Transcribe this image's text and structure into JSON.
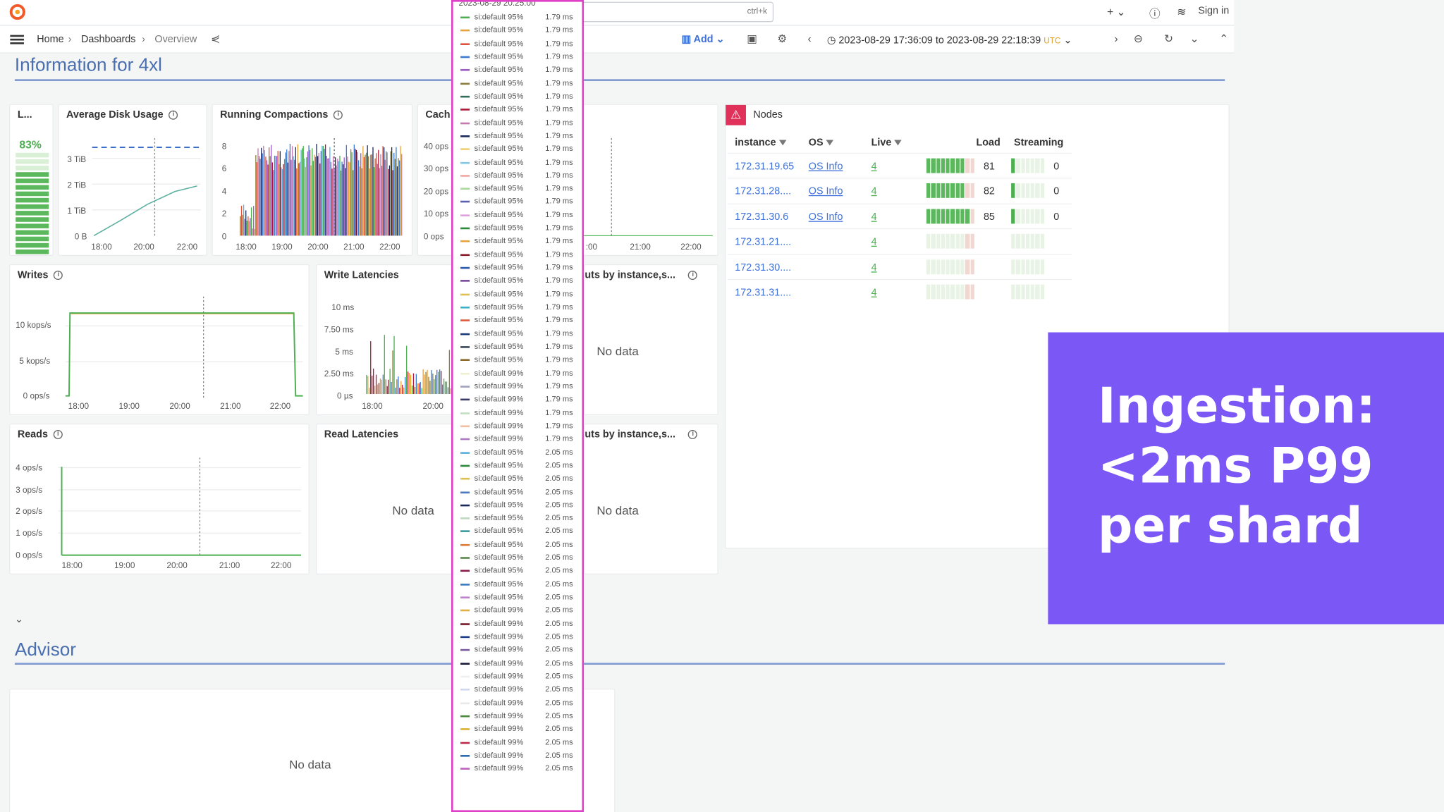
{
  "topbar": {
    "search_shortcut": "ctrl+k",
    "plus_label": "+ ⌄",
    "help_icon": "help-icon",
    "news_icon": "rss-icon",
    "signin_label": "Sign in"
  },
  "breadcrumb": {
    "home": "Home",
    "dashboards": "Dashboards",
    "current": "Overview"
  },
  "toolbar": {
    "add_label": "Add",
    "time_range": "2023-08-29 17:36:09 to 2023-08-29 22:18:39",
    "timezone": "UTC"
  },
  "sections": {
    "info_title": "Information for 4xl",
    "advisor_title": "Advisor"
  },
  "panels": {
    "live": {
      "title": "L...",
      "value": "83%",
      "fraction": 0.83
    },
    "disk": {
      "title": "Average Disk Usage",
      "y_ticks": [
        "3 TiB",
        "2 TiB",
        "1 TiB",
        "0 B"
      ],
      "x_ticks": [
        "18:00",
        "20:00",
        "22:00"
      ]
    },
    "compactions": {
      "title": "Running Compactions",
      "y_ticks": [
        "8",
        "6",
        "4",
        "2",
        "0"
      ],
      "x_ticks": [
        "18:00",
        "19:00",
        "20:00",
        "21:00",
        "22:00"
      ]
    },
    "cache": {
      "title": "Cach",
      "y_ticks": [
        "40 ops",
        "30 ops",
        "20 ops",
        "10 ops",
        "0 ops"
      ],
      "x_ticks": [
        ":00",
        "21:00",
        "22:00"
      ]
    },
    "writes": {
      "title": "Writes",
      "y_ticks": [
        "10 kops/s",
        "5 kops/s",
        "0 ops/s"
      ],
      "x_ticks": [
        "18:00",
        "19:00",
        "20:00",
        "21:00",
        "22:00"
      ]
    },
    "write_latencies": {
      "title": "Write Latencies",
      "y_ticks": [
        "10 ms",
        "7.50 ms",
        "5 ms",
        "2.50 ms",
        "0 µs"
      ],
      "x_ticks": [
        "18:00",
        "20:00"
      ]
    },
    "timeouts_write": {
      "title": "uts by instance,s...",
      "empty": "No data"
    },
    "reads": {
      "title": "Reads",
      "y_ticks": [
        "4 ops/s",
        "3 ops/s",
        "2 ops/s",
        "1 ops/s",
        "0 ops/s"
      ],
      "x_ticks": [
        "18:00",
        "19:00",
        "20:00",
        "21:00",
        "22:00"
      ]
    },
    "read_latencies": {
      "title": "Read Latencies",
      "empty": "No data"
    },
    "timeouts_read": {
      "title": "uts by instance,s...",
      "empty": "No data"
    },
    "advisor_panel": {
      "empty": "No data"
    }
  },
  "nodes": {
    "title": "Nodes",
    "columns": [
      "instance",
      "OS",
      "Live",
      "Load",
      "Streaming"
    ],
    "rows": [
      {
        "instance": "172.31.19.65",
        "os": "OS Info",
        "live": "4",
        "load": "81",
        "load_frac": 0.81,
        "streaming": "0"
      },
      {
        "instance": "172.31.28....",
        "os": "OS Info",
        "live": "4",
        "load": "82",
        "load_frac": 0.82,
        "streaming": "0"
      },
      {
        "instance": "172.31.30.6",
        "os": "OS Info",
        "live": "4",
        "load": "85",
        "load_frac": 0.85,
        "streaming": "0"
      },
      {
        "instance": "172.31.21....",
        "os": "",
        "live": "4",
        "load": "",
        "load_frac": 0,
        "streaming": ""
      },
      {
        "instance": "172.31.30....",
        "os": "",
        "live": "4",
        "load": "",
        "load_frac": 0,
        "streaming": ""
      },
      {
        "instance": "172.31.31....",
        "os": "",
        "live": "4",
        "load": "",
        "load_frac": 0,
        "streaming": ""
      }
    ]
  },
  "tooltip": {
    "header": "2023-08-29 20:25:00",
    "rows": [
      {
        "label": "si:default 95%",
        "value": "1.79 ms",
        "color": "#4caf50"
      },
      {
        "label": "si:default 95%",
        "value": "1.79 ms",
        "color": "#e8a33c"
      },
      {
        "label": "si:default 95%",
        "value": "1.79 ms",
        "color": "#e0533c"
      },
      {
        "label": "si:default 95%",
        "value": "1.79 ms",
        "color": "#3a7bd5"
      },
      {
        "label": "si:default 95%",
        "value": "1.79 ms",
        "color": "#9c5cc8"
      },
      {
        "label": "si:default 95%",
        "value": "1.79 ms",
        "color": "#8e7d3a"
      },
      {
        "label": "si:default 95%",
        "value": "1.79 ms",
        "color": "#2f6e5a"
      },
      {
        "label": "si:default 95%",
        "value": "1.79 ms",
        "color": "#b0183a"
      },
      {
        "label": "si:default 95%",
        "value": "1.79 ms",
        "color": "#c47ab0"
      },
      {
        "label": "si:default 95%",
        "value": "1.79 ms",
        "color": "#1d2a5c"
      },
      {
        "label": "si:default 95%",
        "value": "1.79 ms",
        "color": "#f0d070"
      },
      {
        "label": "si:default 95%",
        "value": "1.79 ms",
        "color": "#80c8e8"
      },
      {
        "label": "si:default 95%",
        "value": "1.79 ms",
        "color": "#f4a6a0"
      },
      {
        "label": "si:default 95%",
        "value": "1.79 ms",
        "color": "#a7d89a"
      },
      {
        "label": "si:default 95%",
        "value": "1.79 ms",
        "color": "#5a5fb0"
      },
      {
        "label": "si:default 95%",
        "value": "1.79 ms",
        "color": "#e0a0e0"
      },
      {
        "label": "si:default 95%",
        "value": "1.79 ms",
        "color": "#2a8a3a"
      },
      {
        "label": "si:default 95%",
        "value": "1.79 ms",
        "color": "#e8a33c"
      },
      {
        "label": "si:default 95%",
        "value": "1.79 ms",
        "color": "#8a1a2a"
      },
      {
        "label": "si:default 95%",
        "value": "1.79 ms",
        "color": "#2a5ab0"
      },
      {
        "label": "si:default 95%",
        "value": "1.79 ms",
        "color": "#7a4a9a"
      },
      {
        "label": "si:default 95%",
        "value": "1.79 ms",
        "color": "#e0c050"
      },
      {
        "label": "si:default 95%",
        "value": "1.79 ms",
        "color": "#3ab0c8"
      },
      {
        "label": "si:default 95%",
        "value": "1.79 ms",
        "color": "#e05a3a"
      },
      {
        "label": "si:default 95%",
        "value": "1.79 ms",
        "color": "#1a3a7a"
      },
      {
        "label": "si:default 95%",
        "value": "1.79 ms",
        "color": "#3a4a5a"
      },
      {
        "label": "si:default 95%",
        "value": "1.79 ms",
        "color": "#8a6a2a"
      },
      {
        "label": "si:default 99%",
        "value": "1.79 ms",
        "color": "#f0f0d0"
      },
      {
        "label": "si:default 99%",
        "value": "1.79 ms",
        "color": "#a0a0c0"
      },
      {
        "label": "si:default 99%",
        "value": "1.79 ms",
        "color": "#3a3a6a"
      },
      {
        "label": "si:default 99%",
        "value": "1.79 ms",
        "color": "#c0e0c0"
      },
      {
        "label": "si:default 99%",
        "value": "1.79 ms",
        "color": "#f0c0a0"
      },
      {
        "label": "si:default 99%",
        "value": "1.79 ms",
        "color": "#b07ac0"
      },
      {
        "label": "si:default 95%",
        "value": "2.05 ms",
        "color": "#5ab0e0"
      },
      {
        "label": "si:default 95%",
        "value": "2.05 ms",
        "color": "#2a8a3a"
      },
      {
        "label": "si:default 95%",
        "value": "2.05 ms",
        "color": "#e0c050"
      },
      {
        "label": "si:default 95%",
        "value": "2.05 ms",
        "color": "#4a7ac0"
      },
      {
        "label": "si:default 95%",
        "value": "2.05 ms",
        "color": "#1a2a5a"
      },
      {
        "label": "si:default 95%",
        "value": "2.05 ms",
        "color": "#c0d8c0"
      },
      {
        "label": "si:default 95%",
        "value": "2.05 ms",
        "color": "#3a9aa0"
      },
      {
        "label": "si:default 95%",
        "value": "2.05 ms",
        "color": "#e07a3a"
      },
      {
        "label": "si:default 95%",
        "value": "2.05 ms",
        "color": "#5a8a4a"
      },
      {
        "label": "si:default 95%",
        "value": "2.05 ms",
        "color": "#8a1a4a"
      },
      {
        "label": "si:default 95%",
        "value": "2.05 ms",
        "color": "#3a7ac0"
      },
      {
        "label": "si:default 95%",
        "value": "2.05 ms",
        "color": "#c080d0"
      },
      {
        "label": "si:default 99%",
        "value": "2.05 ms",
        "color": "#e0b040"
      },
      {
        "label": "si:default 99%",
        "value": "2.05 ms",
        "color": "#7a1a2a"
      },
      {
        "label": "si:default 99%",
        "value": "2.05 ms",
        "color": "#1a3a8a"
      },
      {
        "label": "si:default 99%",
        "value": "2.05 ms",
        "color": "#7a5aa0"
      },
      {
        "label": "si:default 99%",
        "value": "2.05 ms",
        "color": "#1a1a3a"
      },
      {
        "label": "si:default 99%",
        "value": "2.05 ms",
        "color": "#f0f0f0"
      },
      {
        "label": "si:default 99%",
        "value": "2.05 ms",
        "color": "#d0d8f0"
      },
      {
        "label": "si:default 99%",
        "value": "2.05 ms",
        "color": "#e8e8e8"
      },
      {
        "label": "si:default 99%",
        "value": "2.05 ms",
        "color": "#4a8a3a"
      },
      {
        "label": "si:default 99%",
        "value": "2.05 ms",
        "color": "#e0b030"
      },
      {
        "label": "si:default 99%",
        "value": "2.05 ms",
        "color": "#c02a4a"
      },
      {
        "label": "si:default 99%",
        "value": "2.05 ms",
        "color": "#2a6ab0"
      },
      {
        "label": "si:default 99%",
        "value": "2.05 ms",
        "color": "#c060c0"
      }
    ]
  },
  "callout": {
    "line1": "Ingestion:",
    "line2": "<2ms P99",
    "line3": "per shard"
  }
}
